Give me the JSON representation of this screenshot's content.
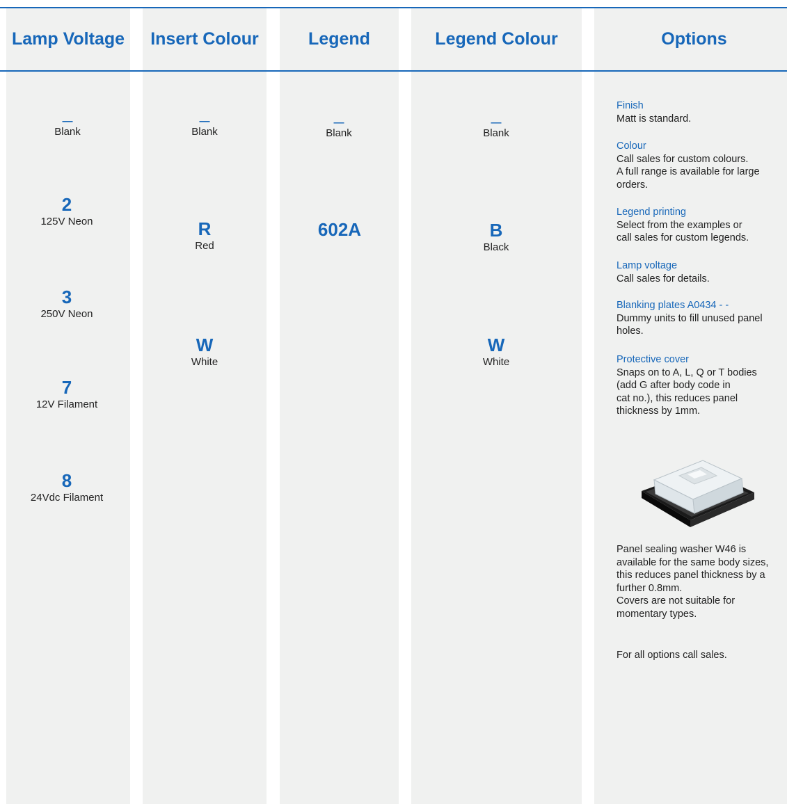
{
  "headers": {
    "lamp_voltage": "Lamp Voltage",
    "insert_colour": "Insert Colour",
    "legend": "Legend",
    "legend_colour": "Legend Colour",
    "options": "Options"
  },
  "dash": "—",
  "lamp_voltage": [
    {
      "code": "",
      "label": "Blank"
    },
    {
      "code": "2",
      "label": "125V Neon"
    },
    {
      "code": "3",
      "label": "250V Neon"
    },
    {
      "code": "7",
      "label": "12V Filament"
    },
    {
      "code": "8",
      "label": "24Vdc Filament"
    }
  ],
  "insert_colour": [
    {
      "code": "",
      "label": "Blank"
    },
    {
      "code": "R",
      "label": "Red"
    },
    {
      "code": "W",
      "label": "White"
    }
  ],
  "legend": [
    {
      "code": "",
      "label": "Blank"
    },
    {
      "code": "602A",
      "label": ""
    }
  ],
  "legend_colour": [
    {
      "code": "",
      "label": "Blank"
    },
    {
      "code": "B",
      "label": "Black"
    },
    {
      "code": "W",
      "label": "White"
    }
  ],
  "options": {
    "notes": [
      {
        "title": "Finish",
        "lines": [
          "Matt is standard."
        ]
      },
      {
        "title": "Colour",
        "lines": [
          "Call sales for custom colours.",
          "A full range is available for large",
          "orders."
        ]
      },
      {
        "title": "Legend printing",
        "lines": [
          "Select from the examples or",
          "call sales for custom legends."
        ]
      },
      {
        "title": "Lamp voltage",
        "lines": [
          "Call sales for details."
        ]
      },
      {
        "title": "Blanking plates A0434 - -",
        "lines": [
          "Dummy units to fill unused panel",
          "holes."
        ]
      },
      {
        "title": "Protective cover",
        "lines": [
          "Snaps on to A, L, Q or T bodies",
          "(add G after body code in",
          "cat no.), this reduces panel",
          "thickness by 1mm."
        ]
      }
    ],
    "washer_lines": [
      "Panel sealing washer W46 is",
      "available for the same body sizes,",
      "this reduces panel thickness by a",
      "further 0.8mm.",
      "Covers are not suitable for",
      "momentary types."
    ],
    "footer": "For all options call sales."
  }
}
